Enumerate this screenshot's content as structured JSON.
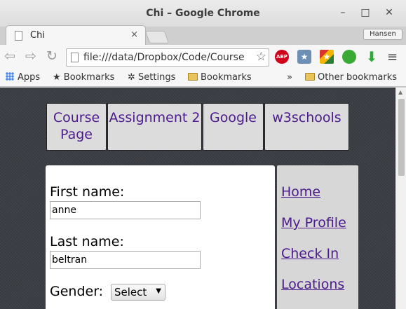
{
  "window": {
    "title": "Chi – Google Chrome"
  },
  "tab": {
    "title": "Chi",
    "close": "×"
  },
  "profile": {
    "name": "Hansen"
  },
  "toolbar": {
    "url": "file:///data/Dropbox/Code/Course",
    "back": "⇦",
    "forward": "⇨",
    "reload": "↻",
    "star": "☆",
    "abp_label": "ABP",
    "ext_star": "★",
    "ext_color": "★",
    "download": "⬇",
    "menu": "≡"
  },
  "bookmarks": {
    "apps": "Apps",
    "items": [
      "Bookmarks",
      "Settings",
      "Bookmarks"
    ],
    "overflow": "»",
    "other": "Other bookmarks"
  },
  "nav": {
    "course_page": "Course Page",
    "assignment": "Assignment 2",
    "google": "Google",
    "w3schools": "w3schools"
  },
  "form": {
    "first_name_label": "First name:",
    "first_name_value": "anne",
    "last_name_label": "Last name:",
    "last_name_value": "beltran",
    "gender_label": "Gender:",
    "gender_selected": "Select"
  },
  "sidebar": {
    "links": [
      "Home",
      "My Profile",
      "Check In",
      "Locations"
    ]
  }
}
